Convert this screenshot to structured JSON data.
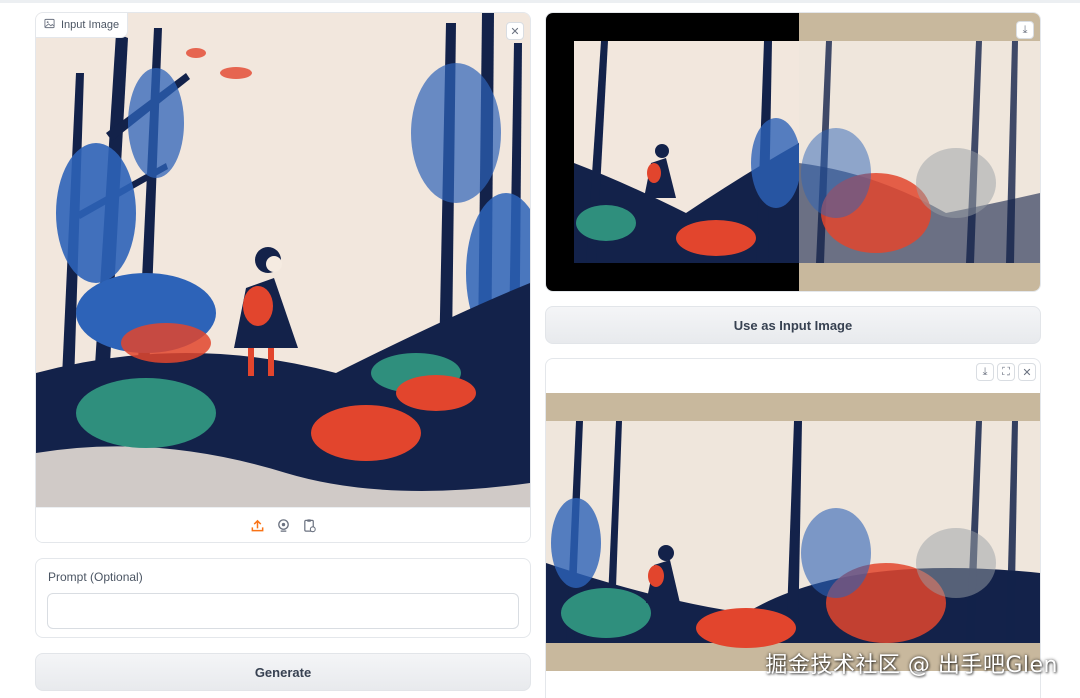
{
  "input_panel": {
    "label": "Input Image",
    "image_icon": "image-icon",
    "clear_icon": "close-icon",
    "sources": [
      {
        "name": "upload-icon",
        "color": "#f97316"
      },
      {
        "name": "webcam-icon",
        "color": "#6b7280"
      },
      {
        "name": "clipboard-icon",
        "color": "#6b7280"
      }
    ]
  },
  "prompt": {
    "label": "Prompt (Optional)",
    "value": "",
    "placeholder": ""
  },
  "generate_button": "Generate",
  "compare_panel": {
    "download_icon": "download-icon"
  },
  "use_as_input_button": "Use as Input Image",
  "output_panel": {
    "icons": [
      "download-icon",
      "fullscreen-icon",
      "close-icon"
    ]
  },
  "watermark": "掘金技术社区 @ 出手吧Glen",
  "colors": {
    "cream": "#f2e7dd",
    "navy": "#13224a",
    "blue": "#2d63b8",
    "red": "#e2452d",
    "teal": "#2f8f7d",
    "wood": "#c8b89d",
    "accent_orange": "#f97316"
  }
}
